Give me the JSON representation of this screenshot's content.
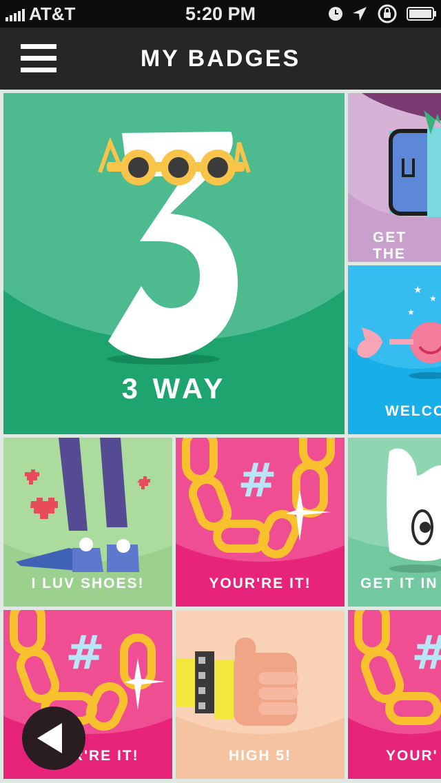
{
  "status_bar": {
    "carrier": "AT&T",
    "time": "5:20 PM"
  },
  "header": {
    "title": "MY BADGES"
  },
  "badges": [
    {
      "label": "3 WAY",
      "bg": "#1ea56f"
    },
    {
      "label": "GET THE",
      "bg": "#c99fcb"
    },
    {
      "label": "WELCO",
      "bg": "#18aee8"
    },
    {
      "label": "I LUV SHOES!",
      "bg": "#9cd08e"
    },
    {
      "label": "YOUR'RE IT!",
      "bg": "#e8237a"
    },
    {
      "label": "GET IT IN",
      "bg": "#72c9a0"
    },
    {
      "label": "YOUR'RE IT!",
      "bg": "#e8237a"
    },
    {
      "label": "HIGH 5!",
      "bg": "#f6c3a0"
    },
    {
      "label": "YOUR'",
      "bg": "#e8237a"
    }
  ],
  "icons": {
    "menu": "hamburger-icon",
    "back": "left-triangle-icon"
  }
}
